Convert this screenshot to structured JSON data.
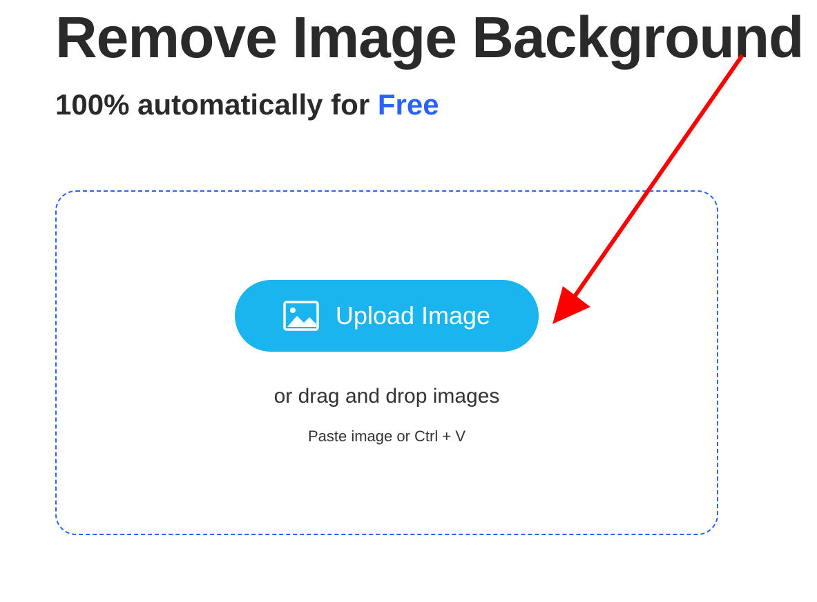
{
  "heading": "Remove Image Background",
  "subtitle_prefix": "100% automatically for ",
  "subtitle_highlight": "Free",
  "upload": {
    "button_label": "Upload Image",
    "drag_text": "or drag and drop images",
    "paste_text": "Paste image or Ctrl + V"
  },
  "colors": {
    "accent_blue": "#2962ff",
    "button_blue": "#1ab4ef",
    "text_dark": "#2a2a2a",
    "arrow_red": "#ff0000"
  }
}
